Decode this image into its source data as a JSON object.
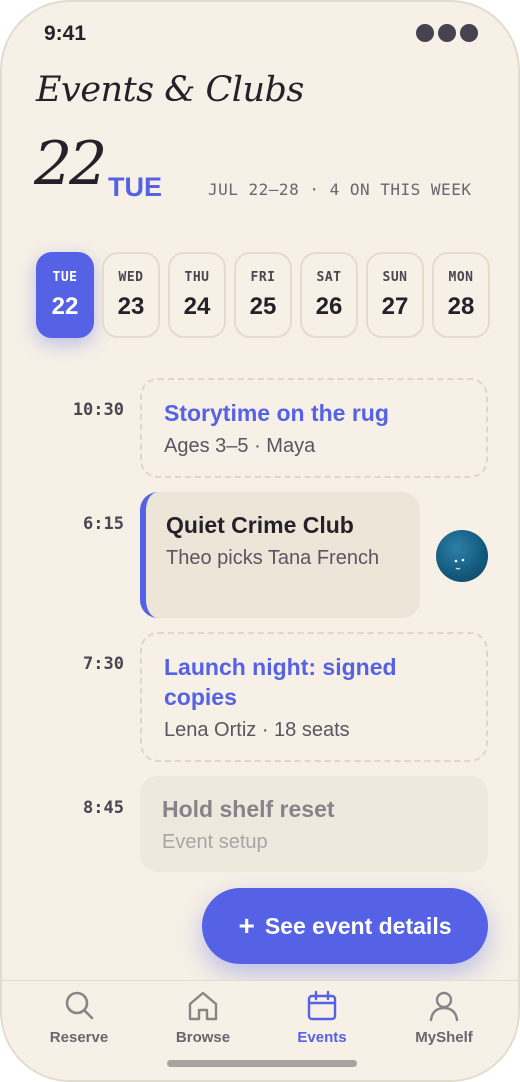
{
  "status": {
    "time": "9:41"
  },
  "app_title": "Events & Clubs",
  "header": {
    "day_number": "22",
    "weekday": "TUE",
    "range": "JUL 22–28 · 4 ON THIS WEEK"
  },
  "days": [
    {
      "dow": "TUE",
      "num": "22",
      "selected": true
    },
    {
      "dow": "WED",
      "num": "23"
    },
    {
      "dow": "THU",
      "num": "24"
    },
    {
      "dow": "FRI",
      "num": "25"
    },
    {
      "dow": "SAT",
      "num": "26"
    },
    {
      "dow": "SUN",
      "num": "27"
    },
    {
      "dow": "MON",
      "num": "28"
    }
  ],
  "events": [
    {
      "time": "10:30",
      "title": "Storytime on the rug",
      "subtitle": "Ages 3–5 · Maya"
    },
    {
      "time": "6:15",
      "title": "Quiet Crime Club",
      "subtitle": "Theo picks Tana French"
    },
    {
      "time": "7:30",
      "title": "Launch night: signed copies",
      "subtitle": "Lena Ortiz · 18 seats"
    },
    {
      "time": "8:45",
      "title": "Hold shelf reset",
      "subtitle": "Event setup"
    }
  ],
  "fab": {
    "icon": "+",
    "label": "See event details"
  },
  "tabs": [
    {
      "label": "Reserve",
      "icon": "search-icon"
    },
    {
      "label": "Browse",
      "icon": "home-icon"
    },
    {
      "label": "Events",
      "icon": "calendar-icon",
      "active": true
    },
    {
      "label": "MyShelf",
      "icon": "person-icon"
    }
  ],
  "colors": {
    "accent": "#5562e6",
    "background": "#f6f0e6",
    "text": "#25212a"
  }
}
